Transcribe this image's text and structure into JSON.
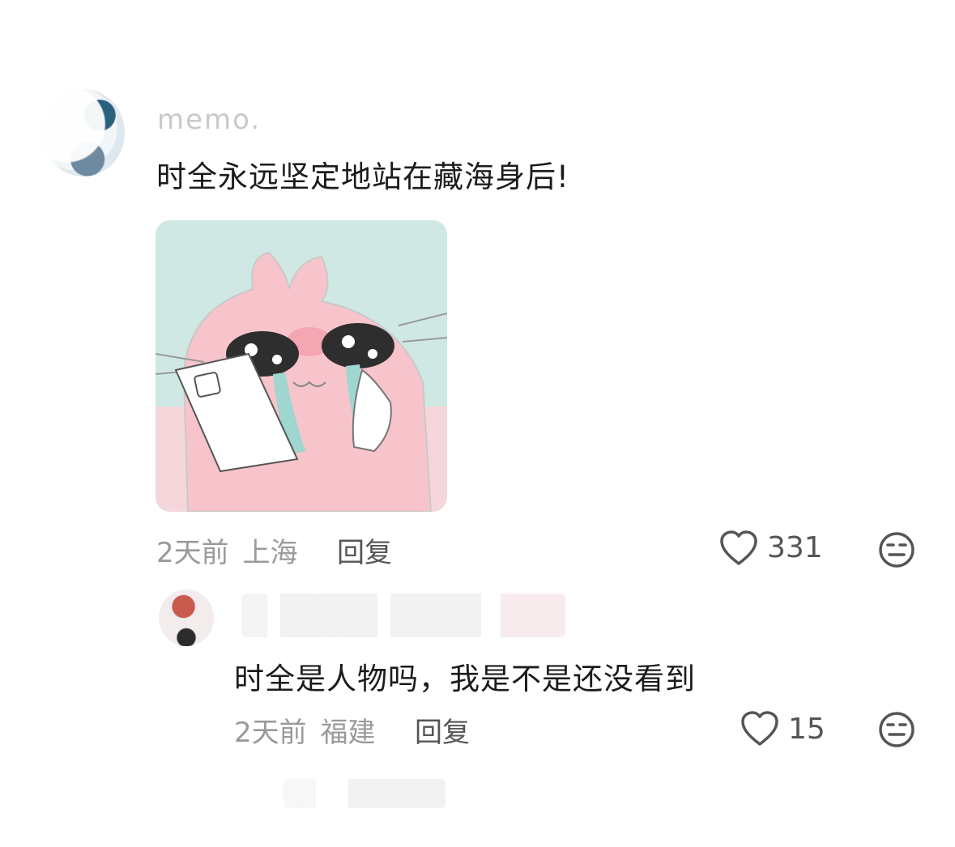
{
  "comments": [
    {
      "username": "memo.",
      "text": "时全永远坚定地站在藏海身后!",
      "sticker": "sticker-image",
      "time": "2天前",
      "location": "上海",
      "reply_label": "回复",
      "likes": "331",
      "icons": {
        "like": "heart-outline-icon",
        "dislike": "meh-face-icon"
      }
    },
    {
      "username": "",
      "text": "时全是人物吗，我是不是还没看到",
      "time": "2天前",
      "location": "福建",
      "reply_label": "回复",
      "likes": "15",
      "icons": {
        "like": "heart-outline-icon",
        "dislike": "meh-face-icon"
      }
    }
  ],
  "colors": {
    "text": "#1b1b1b",
    "meta": "#9a9a9a",
    "icon": "#555555"
  }
}
